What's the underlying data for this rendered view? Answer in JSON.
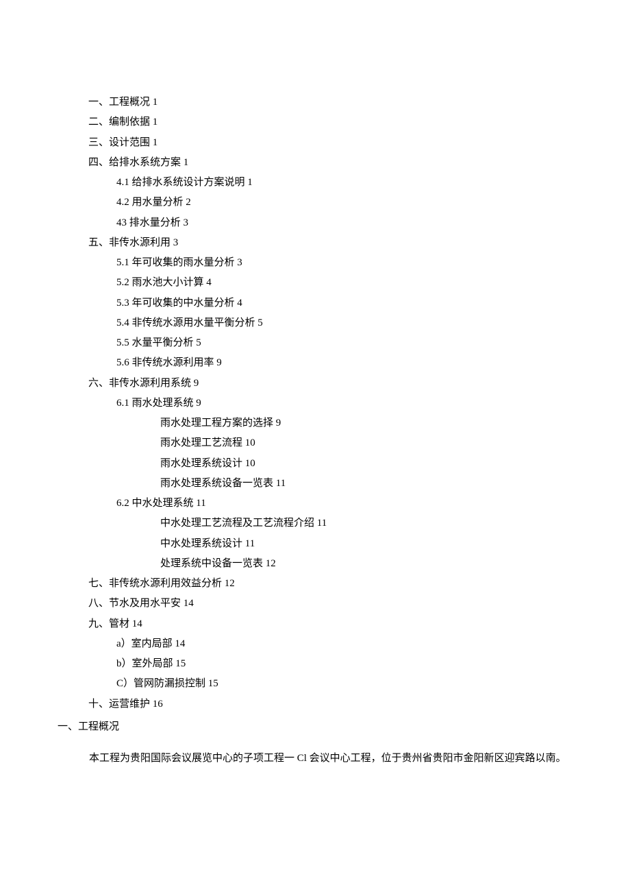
{
  "toc": [
    {
      "level": 1,
      "text": "一、工程概况 1"
    },
    {
      "level": 1,
      "text": "二、编制依据 1"
    },
    {
      "level": 1,
      "text": "三、设计范围 1"
    },
    {
      "level": 1,
      "text": "四、给排水系统方案 1"
    },
    {
      "level": 2,
      "text": "4.1   给排水系统设计方案说明 1"
    },
    {
      "level": 2,
      "text": "4.2   用水量分析 2"
    },
    {
      "level": 2,
      "text": "43 排水量分析 3"
    },
    {
      "level": 1,
      "text": "五、非传水源利用 3"
    },
    {
      "level": 2,
      "text": "5.1   年可收集的雨水量分析 3"
    },
    {
      "level": 2,
      "text": "5.2   雨水池大小计算 4"
    },
    {
      "level": 2,
      "text": "5.3   年可收集的中水量分析 4"
    },
    {
      "level": 2,
      "text": "5.4   非传统水源用水量平衡分析 5"
    },
    {
      "level": 2,
      "text": "5.5   水量平衡分析 5"
    },
    {
      "level": 2,
      "text": "5.6   非传统水源利用率 9"
    },
    {
      "level": 1,
      "text": "六、非传水源利用系统 9"
    },
    {
      "level": 2,
      "text": "6.1   雨水处理系统 9"
    },
    {
      "level": 3,
      "text": "雨水处理工程方案的选择 9"
    },
    {
      "level": 3,
      "text": "雨水处理工艺流程 10"
    },
    {
      "level": 3,
      "text": "雨水处理系统设计 10"
    },
    {
      "level": 3,
      "text": "雨水处理系统设备一览表 11"
    },
    {
      "level": 2,
      "text": "6.2   中水处理系统 11"
    },
    {
      "level": 3,
      "text": "中水处理工艺流程及工艺流程介绍 11"
    },
    {
      "level": 3,
      "text": "中水处理系统设计 11"
    },
    {
      "level": 3,
      "text": "处理系统中设备一览表 12"
    },
    {
      "level": 1,
      "text": "七、非传统水源利用效益分析 12"
    },
    {
      "level": 1,
      "text": "八、节水及用水平安 14"
    },
    {
      "level": 1,
      "text": "九、管材 14"
    },
    {
      "level": 2,
      "text": "a）室内局部 14"
    },
    {
      "level": 2,
      "text": "b）室外局部 15"
    },
    {
      "level": 2,
      "text": "C）管网防漏损控制 15"
    },
    {
      "level": 1,
      "text": "十、运营维护 16"
    }
  ],
  "heading": "一、工程概况",
  "paragraph": "本工程为贵阳国际会议展览中心的子项工程一 Cl 会议中心工程，位于贵州省贵阳市金阳新区迎宾路以南。"
}
